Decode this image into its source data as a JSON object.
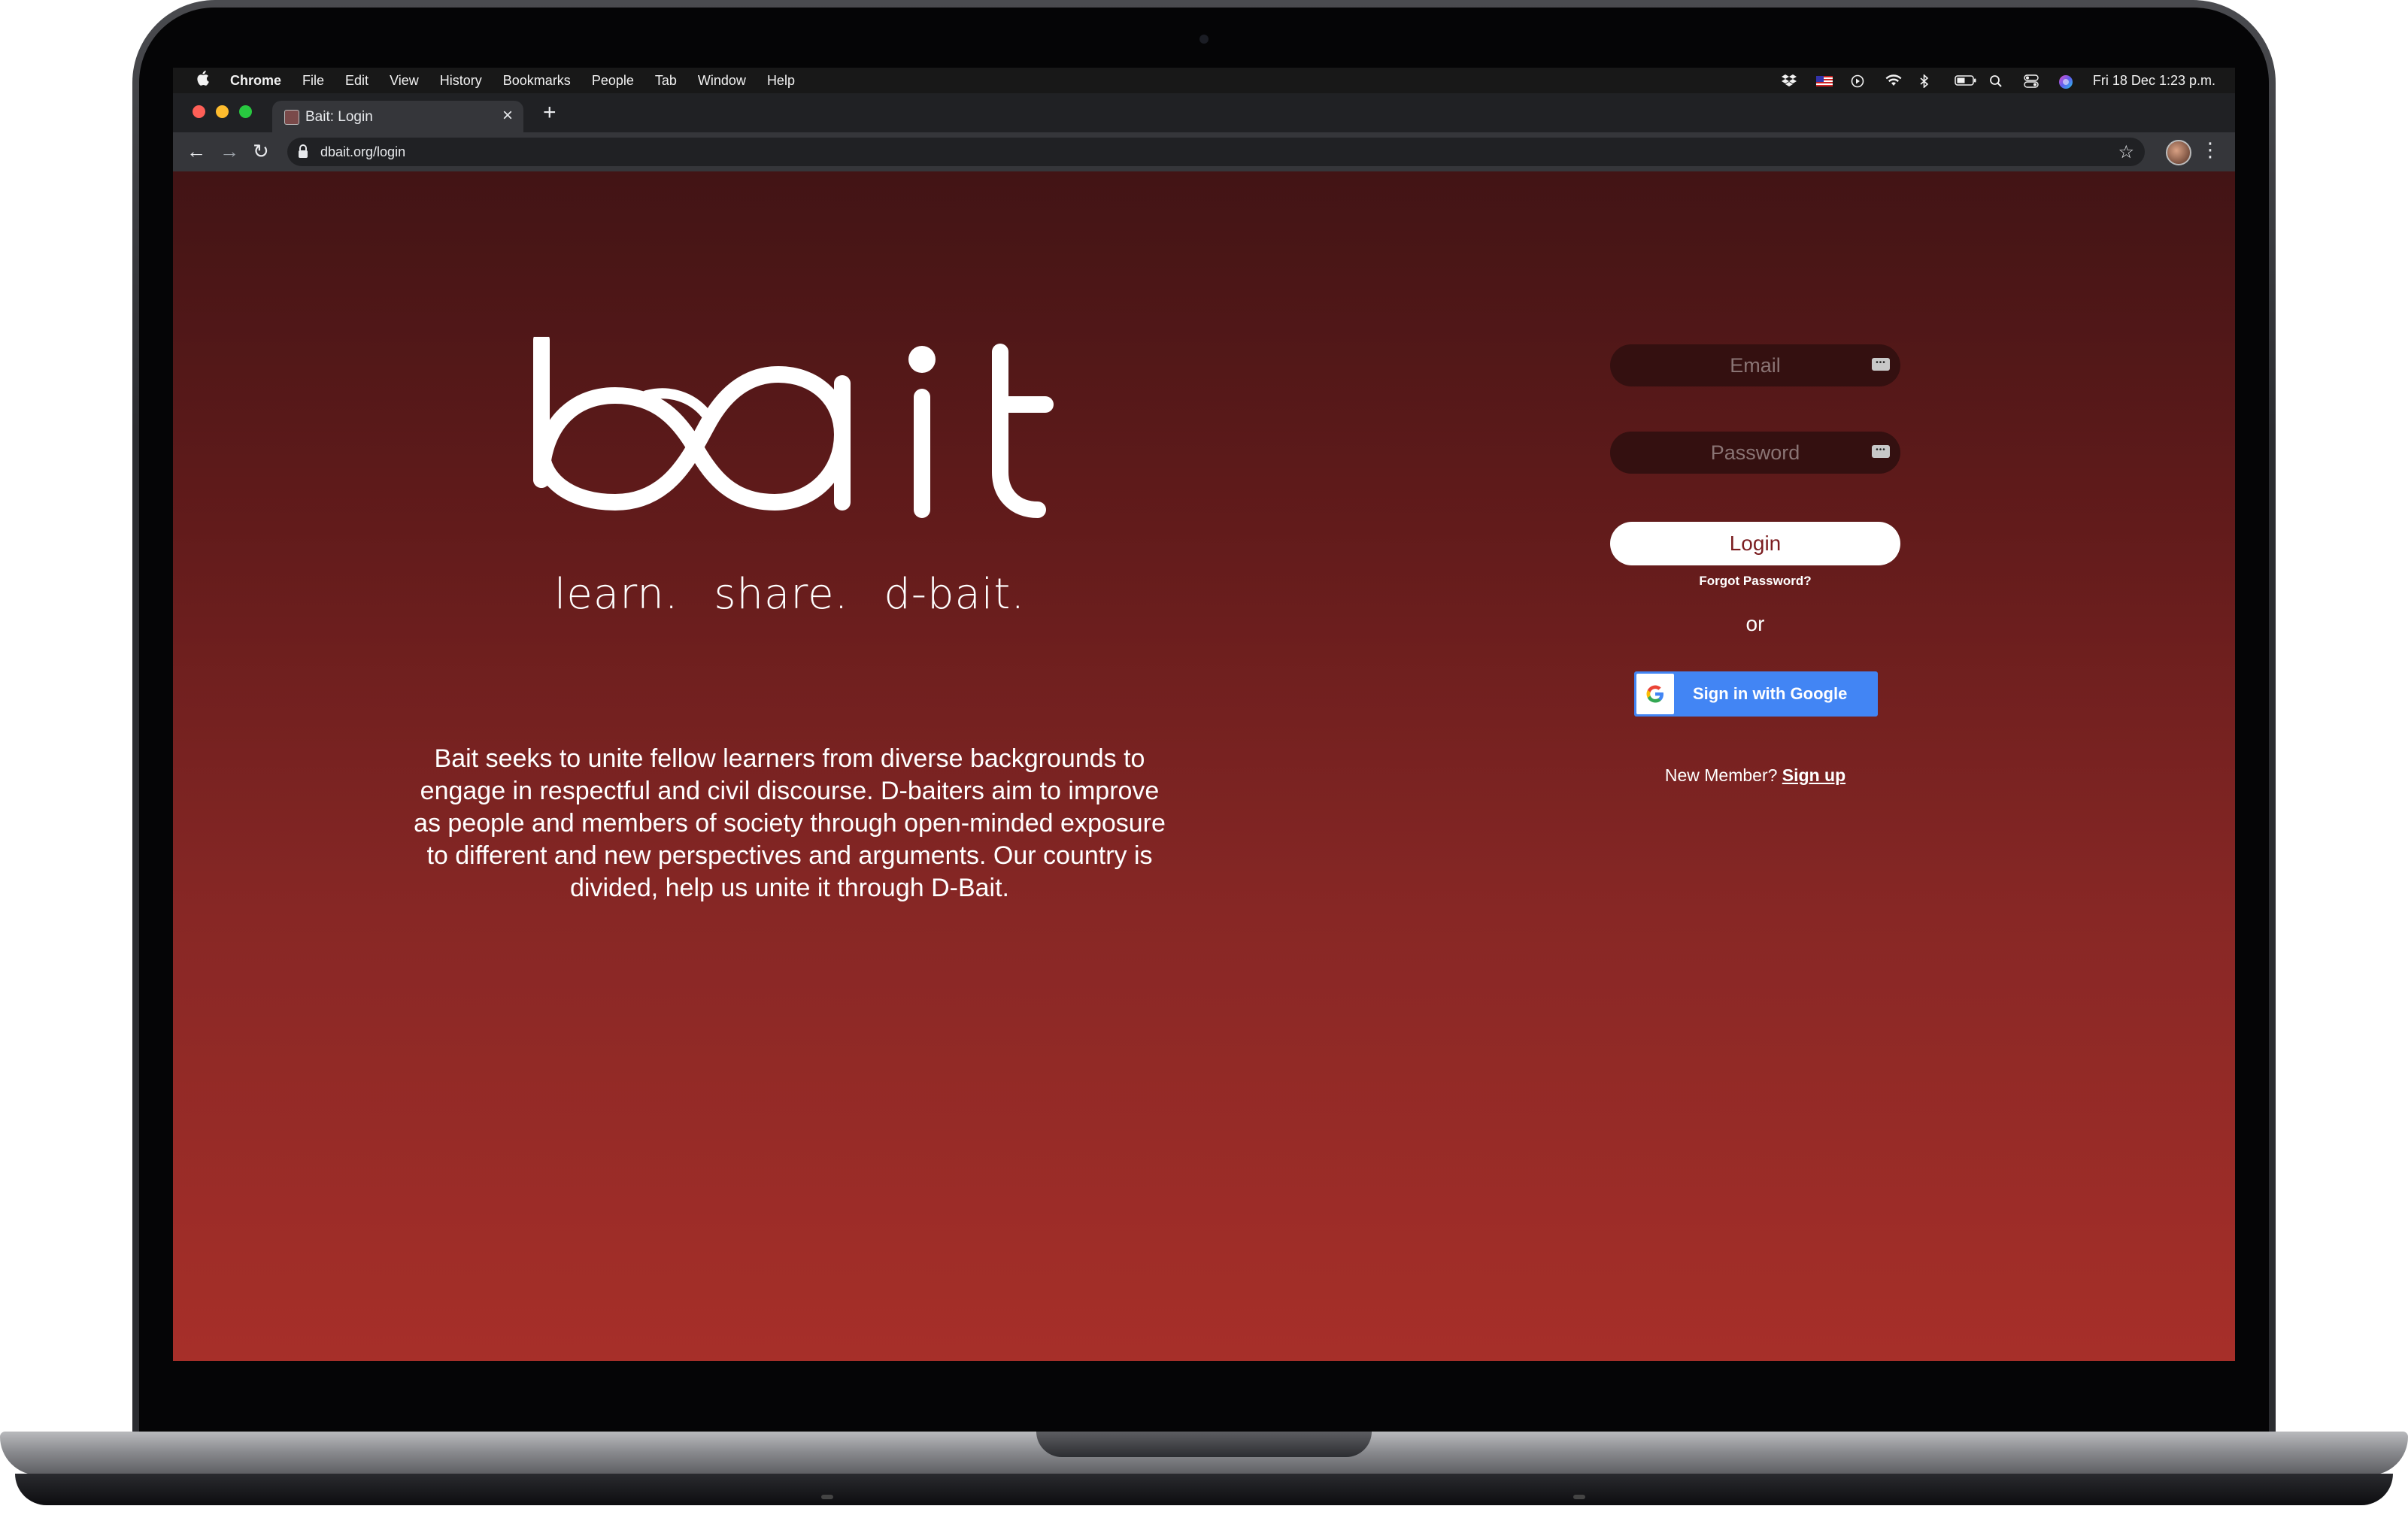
{
  "menubar": {
    "app_name": "Chrome",
    "items": [
      "File",
      "Edit",
      "View",
      "History",
      "Bookmarks",
      "People",
      "Tab",
      "Window",
      "Help"
    ],
    "clock": "Fri 18 Dec  1:23 p.m."
  },
  "browser": {
    "tab_title": "Bait: Login",
    "close_glyph": "×",
    "new_tab_glyph": "+",
    "url": "dbait.org/login",
    "back_glyph": "←",
    "forward_glyph": "→",
    "reload_glyph": "↻",
    "star_glyph": "☆",
    "menu_glyph": "⋮"
  },
  "hero": {
    "logo": "bait",
    "tagline": [
      "learn.",
      "share.",
      "d-bait."
    ],
    "description": "Bait seeks to unite fellow learners from diverse backgrounds to engage in respectful and civil discourse. D-baiters aim to improve as people and members of society through open-minded exposure to different and new perspectives and arguments. Our country is divided, help us unite it through D-Bait."
  },
  "login": {
    "email_placeholder": "Email",
    "password_placeholder": "Password",
    "key_glyph": "•••",
    "login_label": "Login",
    "forgot_label": "Forgot Password?",
    "or_label": "or",
    "google_label": "Sign in with Google",
    "new_member_label": "New Member?",
    "signup_label": "Sign up"
  },
  "colors": {
    "page_gradient_top": "#421415",
    "page_gradient_bottom": "#a72f29",
    "field_bg": "#341010",
    "login_text": "#7b1d20",
    "google_blue": "#4285f4"
  }
}
